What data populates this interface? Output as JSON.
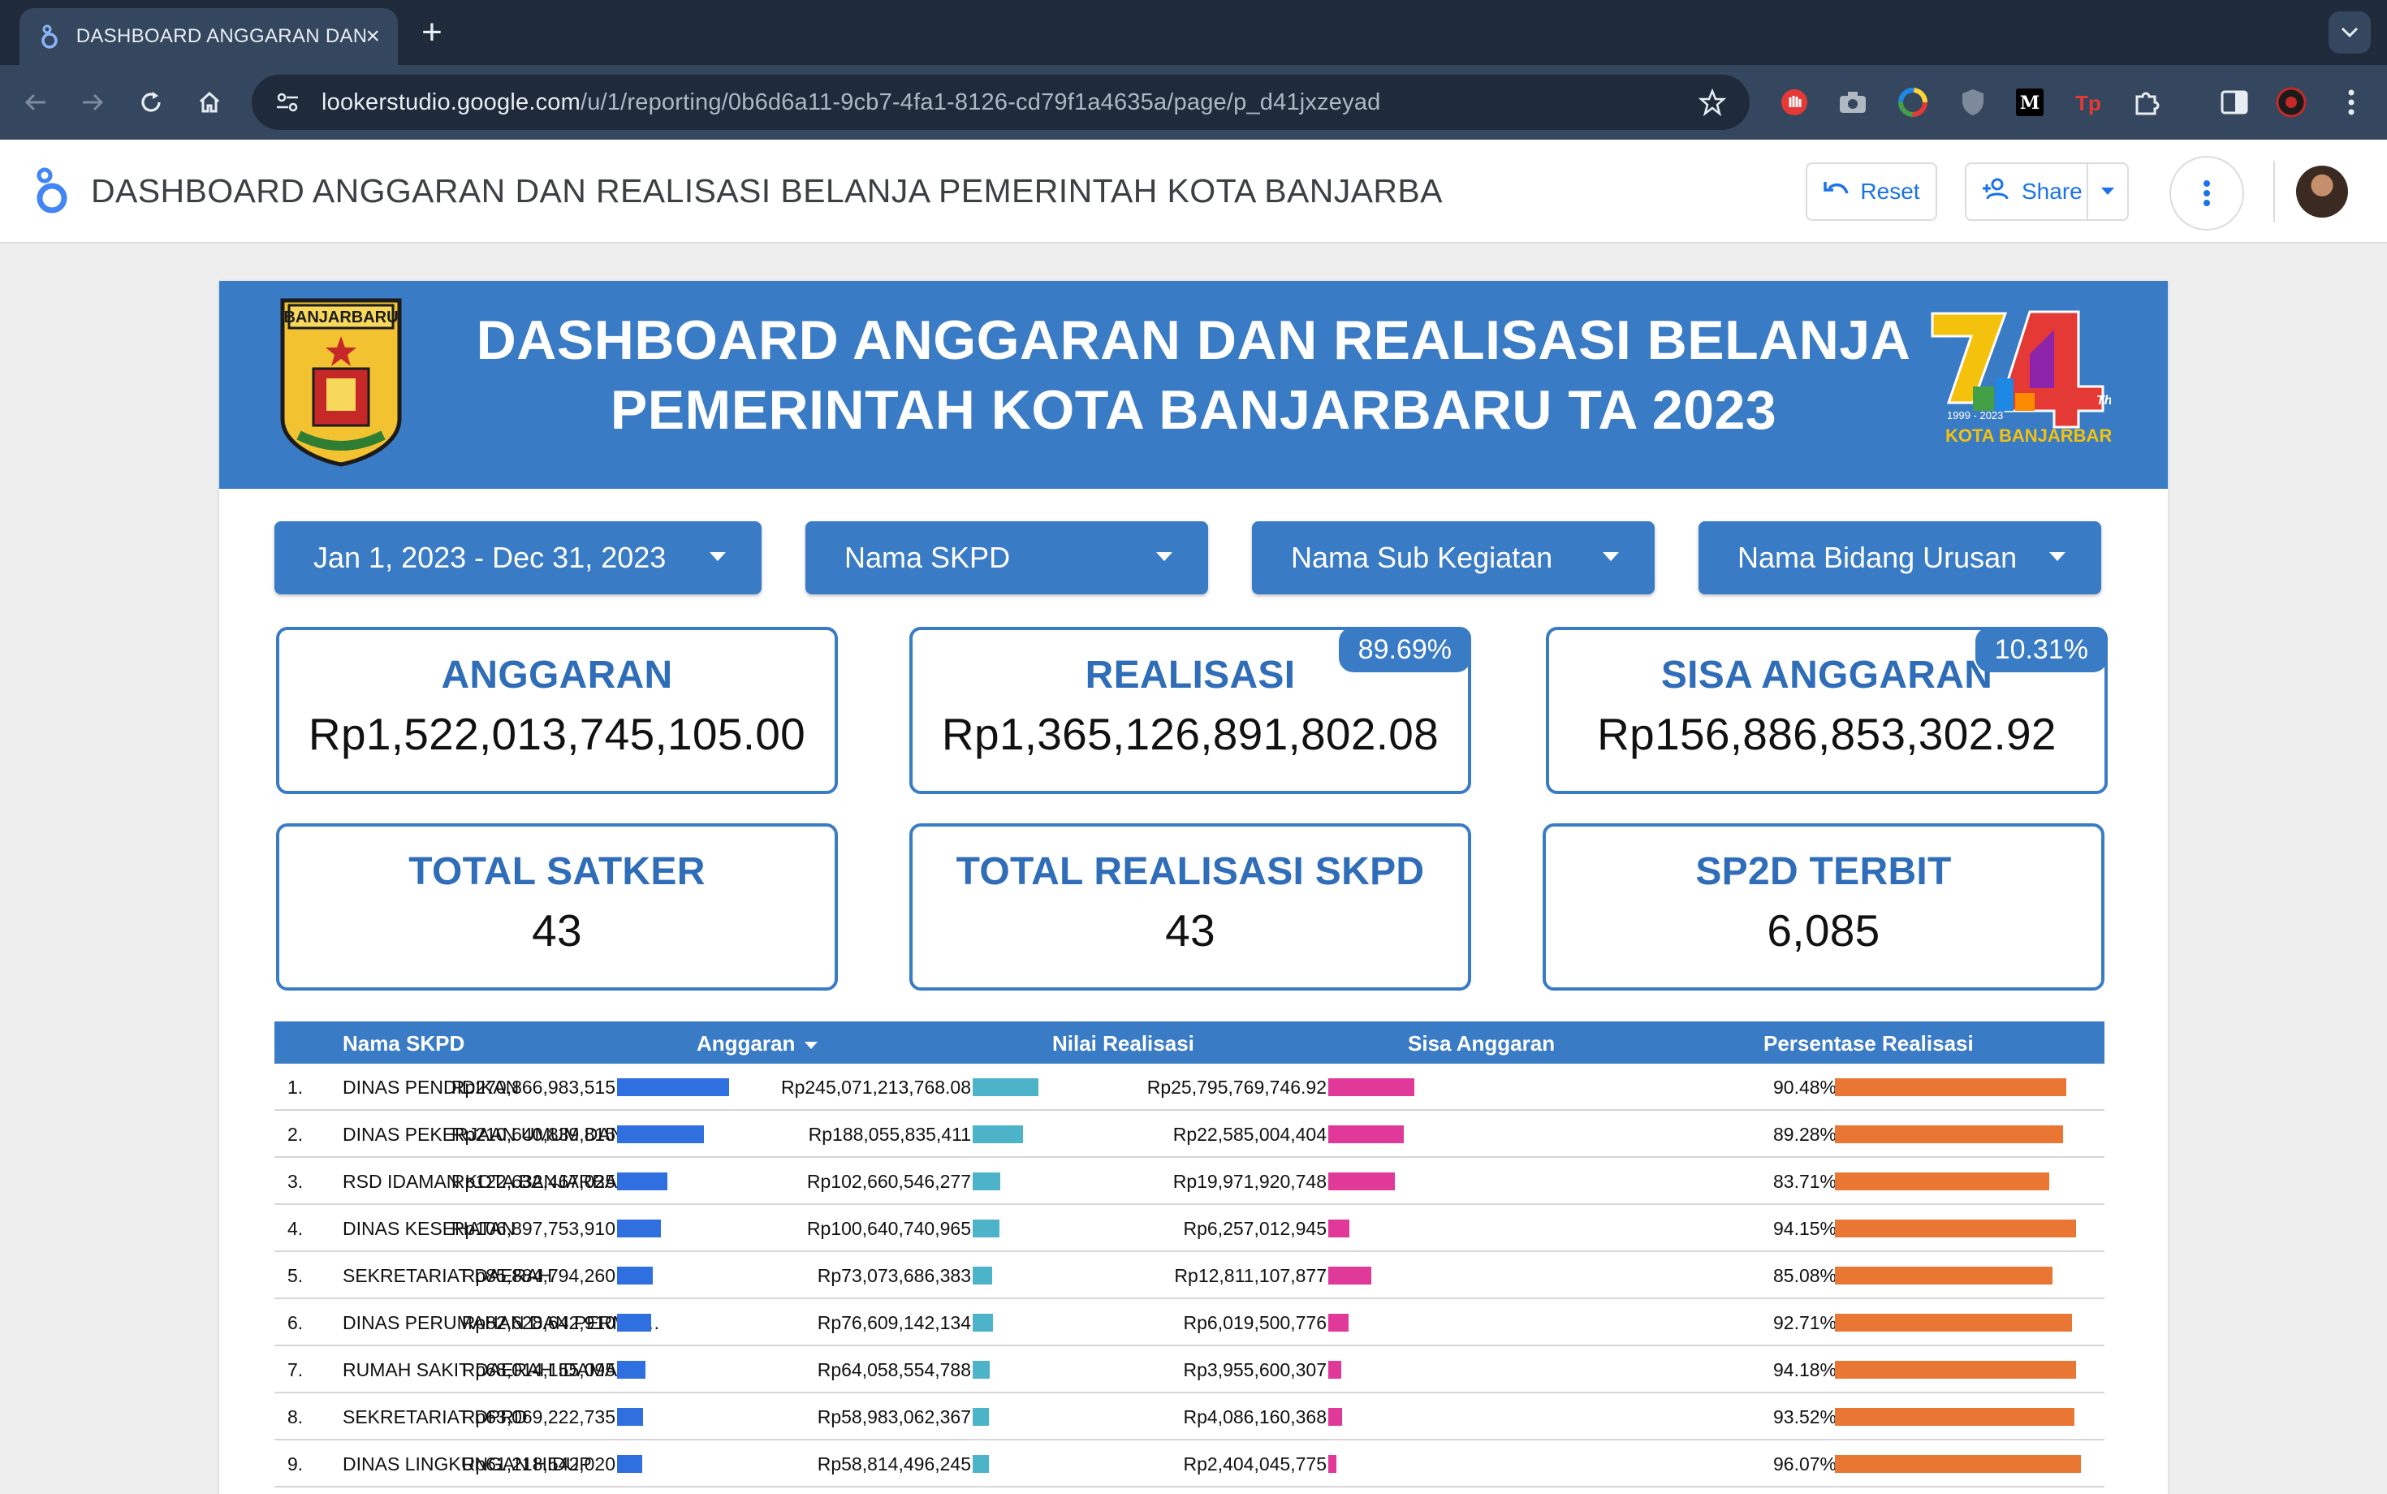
{
  "browser": {
    "tab_title": "DASHBOARD ANGGARAN DAN REALISASI BELANJA",
    "url_host": "lookerstudio.google.com",
    "url_path": "/u/1/reporting/0b6d6a11-9cb7-4fa1-8126-cd79f1a4635a/page/p_d41jxzeyad"
  },
  "app": {
    "title": "DASHBOARD ANGGARAN DAN REALISASI BELANJA PEMERINTAH KOTA BANJARBA",
    "reset_label": "Reset",
    "share_label": "Share"
  },
  "banner": {
    "title_line1": "DASHBOARD ANGGARAN DAN REALISASI BELANJA",
    "title_line2": "PEMERINTAH KOTA BANJARBARU TA 2023",
    "crest_text": "BANJARBARU",
    "anniv_text": "KOTA BANJARBARU",
    "anniv_years": "1999 - 2023"
  },
  "filters": {
    "date_range": "Jan 1, 2023 - Dec 31, 2023",
    "skpd": "Nama SKPD",
    "sub_kegiatan": "Nama Sub Kegiatan",
    "bidang_urusan": "Nama Bidang Urusan"
  },
  "cards": {
    "anggaran": {
      "label": "ANGGARAN",
      "value": "Rp1,522,013,745,105.00"
    },
    "realisasi": {
      "label": "REALISASI",
      "value": "Rp1,365,126,891,802.08",
      "badge": "89.69%"
    },
    "sisa": {
      "label": "SISA ANGGARAN",
      "value": "Rp156,886,853,302.92",
      "badge": "10.31%"
    },
    "satker": {
      "label": "TOTAL SATKER",
      "value": "43"
    },
    "realisasi_skpd": {
      "label": "TOTAL REALISASI SKPD",
      "value": "43"
    },
    "sp2d": {
      "label": "SP2D TERBIT",
      "value": "6,085"
    }
  },
  "table": {
    "headers": {
      "name": "Nama SKPD",
      "anggaran": "Anggaran",
      "realisasi": "Nilai Realisasi",
      "sisa": "Sisa Anggaran",
      "persen": "Persentase Realisasi"
    },
    "colors": {
      "anggaran": "#2f6fe0",
      "realisasi": "#4db3c9",
      "sisa": "#e0399a",
      "persen": "#ea7633"
    },
    "rows": [
      {
        "num": "1.",
        "name": "DINAS PENDIDIKAN",
        "anggaran": "Rp270,866,983,515",
        "anggaran_v": 270866983515,
        "realisasi": "Rp245,071,213,768.08",
        "realisasi_v": 245071213768.08,
        "sisa": "Rp25,795,769,746.92",
        "sisa_v": 25795769746.92,
        "persen": "90.48%",
        "persen_v": 90.48
      },
      {
        "num": "2.",
        "name": "DINAS PEKERJAAN UMUM DAN PE…",
        "anggaran": "Rp210,640,839,815",
        "anggaran_v": 210640839815,
        "realisasi": "Rp188,055,835,411",
        "realisasi_v": 188055835411,
        "sisa": "Rp22,585,004,404",
        "sisa_v": 22585004404,
        "persen": "89.28%",
        "persen_v": 89.28
      },
      {
        "num": "3.",
        "name": "RSD IDAMAN KOTA BANJARBARU (…",
        "anggaran": "Rp122,632,467,025",
        "anggaran_v": 122632467025,
        "realisasi": "Rp102,660,546,277",
        "realisasi_v": 102660546277,
        "sisa": "Rp19,971,920,748",
        "sisa_v": 19971920748,
        "persen": "83.71%",
        "persen_v": 83.71
      },
      {
        "num": "4.",
        "name": "DINAS KESEHATAN",
        "anggaran": "Rp106,897,753,910",
        "anggaran_v": 106897753910,
        "realisasi": "Rp100,640,740,965",
        "realisasi_v": 100640740965,
        "sisa": "Rp6,257,012,945",
        "sisa_v": 6257012945,
        "persen": "94.15%",
        "persen_v": 94.15
      },
      {
        "num": "5.",
        "name": "SEKRETARIAT DAERAH",
        "anggaran": "Rp85,884,794,260",
        "anggaran_v": 85884794260,
        "realisasi": "Rp73,073,686,383",
        "realisasi_v": 73073686383,
        "sisa": "Rp12,811,107,877",
        "sisa_v": 12811107877,
        "persen": "85.08%",
        "persen_v": 85.08
      },
      {
        "num": "6.",
        "name": "DINAS PERUMAHAN DAN PERMUKI…",
        "anggaran": "Rp82,628,642,910",
        "anggaran_v": 82628642910,
        "realisasi": "Rp76,609,142,134",
        "realisasi_v": 76609142134,
        "sisa": "Rp6,019,500,776",
        "sisa_v": 6019500776,
        "persen": "92.71%",
        "persen_v": 92.71
      },
      {
        "num": "7.",
        "name": "RUMAH SAKIT DAERAH IDAMAN",
        "anggaran": "Rp68,014,155,095",
        "anggaran_v": 68014155095,
        "realisasi": "Rp64,058,554,788",
        "realisasi_v": 64058554788,
        "sisa": "Rp3,955,600,307",
        "sisa_v": 3955600307,
        "persen": "94.18%",
        "persen_v": 94.18
      },
      {
        "num": "8.",
        "name": "SEKRETARIAT DPRD",
        "anggaran": "Rp63,069,222,735",
        "anggaran_v": 63069222735,
        "realisasi": "Rp58,983,062,367",
        "realisasi_v": 58983062367,
        "sisa": "Rp4,086,160,368",
        "sisa_v": 4086160368,
        "persen": "93.52%",
        "persen_v": 93.52
      },
      {
        "num": "9.",
        "name": "DINAS LINGKUNGAN HIDUP",
        "anggaran": "Rp61,218,542,020",
        "anggaran_v": 61218542020,
        "realisasi": "Rp58,814,496,245",
        "realisasi_v": 58814496245,
        "sisa": "Rp2,404,045,775",
        "sisa_v": 2404045775,
        "persen": "96.07%",
        "persen_v": 96.07
      }
    ]
  }
}
